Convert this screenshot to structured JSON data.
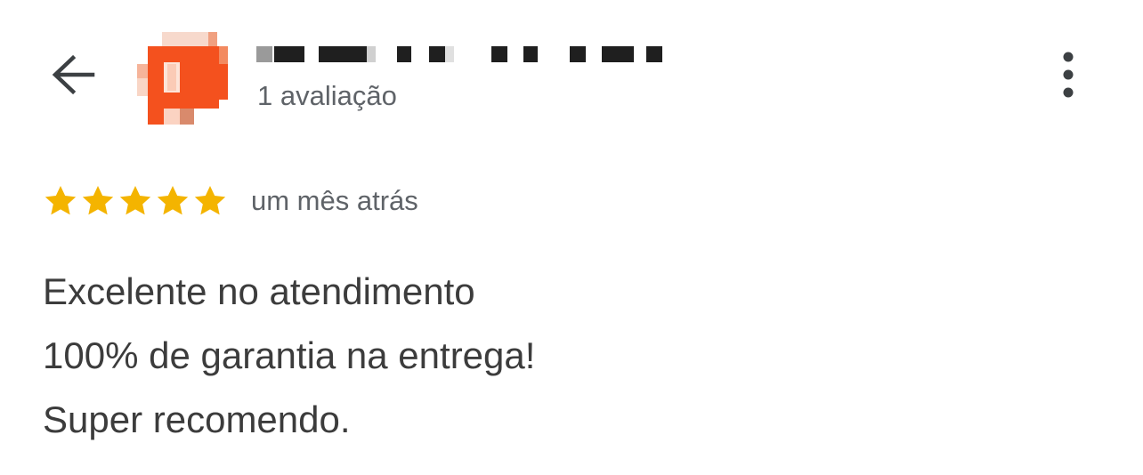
{
  "header": {
    "back_icon": "arrow-left-icon",
    "avatar": "avatar-image",
    "reviewer_name": "",
    "review_count_label": "1 avaliação",
    "menu_icon": "more-vert-icon"
  },
  "review": {
    "rating": 5,
    "rating_max": 5,
    "star_color": "#F4B400",
    "time_ago": "um mês atrás",
    "lines": [
      "Excelente no atendimento",
      "100% de garantia na entrega!",
      "Super recomendo."
    ]
  }
}
